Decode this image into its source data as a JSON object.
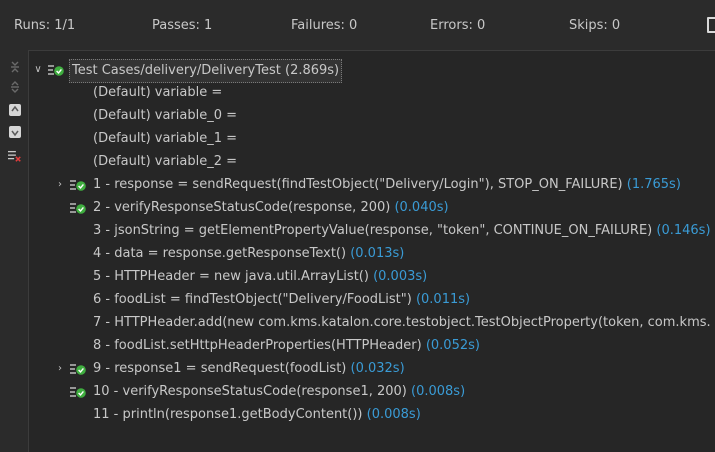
{
  "summary": {
    "runs": "Runs: 1/1",
    "passes": "Passes: 1",
    "failures": "Failures: 0",
    "errors": "Errors: 0",
    "skips": "Skips: 0"
  },
  "toolbar": {
    "buttons": [
      "collapse-all-icon",
      "expand-all-icon",
      "previous-icon",
      "next-icon",
      "show-failures-only-icon"
    ]
  },
  "tree": {
    "root": {
      "label": "Test Cases/delivery/DeliveryTest",
      "time": " (2.869s)"
    },
    "variables": [
      "(Default) variable =",
      "(Default) variable_0 =",
      "(Default) variable_1 =",
      "(Default) variable_2 ="
    ],
    "steps": [
      {
        "label": "1 - response = sendRequest(findTestObject(\"Delivery/Login\"), STOP_ON_FAILURE)",
        "time": " (1.765s)"
      },
      {
        "label": "2 - verifyResponseStatusCode(response, 200)",
        "time": " (0.040s)"
      },
      {
        "label": "3 - jsonString = getElementPropertyValue(response, \"token\", CONTINUE_ON_FAILURE)",
        "time": " (0.146s)"
      },
      {
        "label": "4 - data = response.getResponseText()",
        "time": " (0.013s)"
      },
      {
        "label": "5 - HTTPHeader = new java.util.ArrayList()",
        "time": " (0.003s)"
      },
      {
        "label": "6 - foodList = findTestObject(\"Delivery/FoodList\")",
        "time": " (0.011s)"
      },
      {
        "label": "7 - HTTPHeader.add(new com.kms.katalon.core.testobject.TestObjectProperty(token, com.kms.",
        "time": ""
      },
      {
        "label": "8 - foodList.setHttpHeaderProperties(HTTPHeader)",
        "time": " (0.052s)"
      },
      {
        "label": "9 - response1 = sendRequest(foodList)",
        "time": " (0.032s)"
      },
      {
        "label": "10 - verifyResponseStatusCode(response1, 200)",
        "time": " (0.008s)"
      },
      {
        "label": "11 - println(response1.getBodyContent())",
        "time": " (0.008s)"
      }
    ]
  },
  "colors": {
    "background": "#2b2b2b",
    "panel": "#262626",
    "text": "#c8c8c8",
    "time": "#3a9bd5",
    "pass": "#3fae3f"
  }
}
